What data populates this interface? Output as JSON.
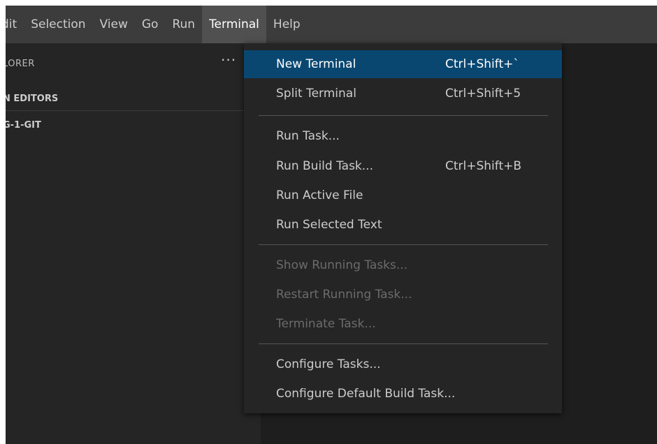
{
  "menubar": {
    "items": [
      "dit",
      "Selection",
      "View",
      "Go",
      "Run",
      "Terminal",
      "Help"
    ],
    "active": "Terminal"
  },
  "sidebar": {
    "title": "LORER",
    "more": "···",
    "open_editors": "N EDITORS",
    "folder": "G-1-GIT"
  },
  "terminal_menu": {
    "items": [
      {
        "label": "New Terminal",
        "shortcut": "Ctrl+Shift+`"
      },
      {
        "label": "Split Terminal",
        "shortcut": "Ctrl+Shift+5"
      },
      {
        "label": "Run Task...",
        "shortcut": ""
      },
      {
        "label": "Run Build Task...",
        "shortcut": "Ctrl+Shift+B"
      },
      {
        "label": "Run Active File",
        "shortcut": ""
      },
      {
        "label": "Run Selected Text",
        "shortcut": ""
      },
      {
        "label": "Show Running Tasks...",
        "shortcut": ""
      },
      {
        "label": "Restart Running Task...",
        "shortcut": ""
      },
      {
        "label": "Terminate Task...",
        "shortcut": ""
      },
      {
        "label": "Configure Tasks...",
        "shortcut": ""
      },
      {
        "label": "Configure Default Build Task...",
        "shortcut": ""
      }
    ]
  },
  "colors": {
    "menubar_bg": "#3c3c3c",
    "editor_bg": "#1e1e1e",
    "sidebar_bg": "#252526",
    "menu_bg": "#252526",
    "selection_bg": "#094771",
    "text": "#cccccc",
    "disabled_text": "#6b6b6b"
  }
}
